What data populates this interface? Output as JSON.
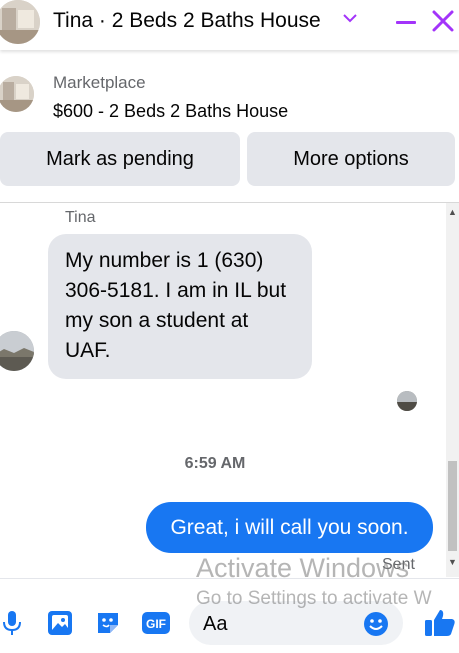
{
  "header": {
    "title": "Tina · 2 Beds 2 Baths House",
    "chevron_icon": "chevron-down-icon",
    "minimize_icon": "minimize-icon",
    "close_icon": "close-icon",
    "accent_color": "#a334fa"
  },
  "listing": {
    "label": "Marketplace",
    "title": "$600 - 2 Beds 2 Baths House"
  },
  "actions": {
    "pending_label": "Mark as pending",
    "more_label": "More options"
  },
  "thread": {
    "sender_name": "Tina",
    "incoming_message": "My number is 1 (630) 306-5181.   I am in IL but my son a student at UAF.",
    "timestamp": "6:59 AM",
    "outgoing_message": "Great, i will call you soon.",
    "status": "Sent",
    "outgoing_color": "#1877f2"
  },
  "composer": {
    "placeholder": "Aa",
    "icons": [
      "microphone-icon",
      "photo-icon",
      "sticker-icon",
      "gif-icon",
      "emoji-icon",
      "thumbs-up-icon"
    ]
  },
  "watermark": {
    "line1": "Activate Windows",
    "line2": "Go to Settings to activate W"
  }
}
